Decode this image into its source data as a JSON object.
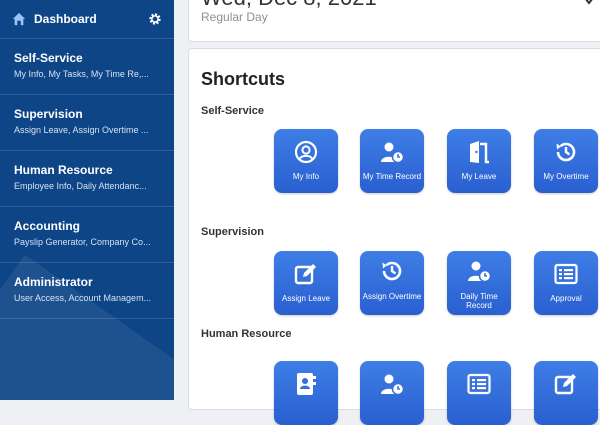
{
  "sidebar": {
    "title": "Dashboard",
    "items": [
      {
        "title": "Self-Service",
        "subtitle": "My Info, My Tasks, My Time Re,..."
      },
      {
        "title": "Supervision",
        "subtitle": "Assign Leave, Assign Overtime ..."
      },
      {
        "title": "Human Resource",
        "subtitle": "Employee Info, Daily Attendanc..."
      },
      {
        "title": "Accounting",
        "subtitle": "Payslip Generator, Company Co..."
      },
      {
        "title": "Administrator",
        "subtitle": "User Access, Account Managem..."
      }
    ]
  },
  "header": {
    "date": "Wed, Dec 8, 2021",
    "day_type": "Regular Day"
  },
  "shortcuts": {
    "heading": "Shortcuts",
    "sections": [
      {
        "label": "Self-Service"
      },
      {
        "label": "Supervision"
      },
      {
        "label": "Human Resource"
      }
    ],
    "self_service": [
      {
        "label": "My Info",
        "icon": "user-circle-icon"
      },
      {
        "label": "My Time Record",
        "icon": "user-clock-icon"
      },
      {
        "label": "My Leave",
        "icon": "door-open-icon"
      },
      {
        "label": "My Overtime",
        "icon": "history-icon"
      }
    ],
    "supervision": [
      {
        "label": "Assign Leave",
        "icon": "edit-icon"
      },
      {
        "label": "Assign Overtime",
        "icon": "history-icon"
      },
      {
        "label": "Daily Time Record",
        "icon": "user-clock-icon"
      },
      {
        "label": "Approval",
        "icon": "list-icon"
      }
    ],
    "human_resource": [
      {
        "label": "",
        "icon": "address-book-icon"
      },
      {
        "label": "",
        "icon": "user-clock-icon"
      },
      {
        "label": "",
        "icon": "list-icon"
      },
      {
        "label": "",
        "icon": "edit-icon"
      }
    ]
  },
  "colors": {
    "sidebar_bg": "#0d4587",
    "tile_top": "#3e7ee6",
    "tile_bottom": "#2a5fd0"
  }
}
